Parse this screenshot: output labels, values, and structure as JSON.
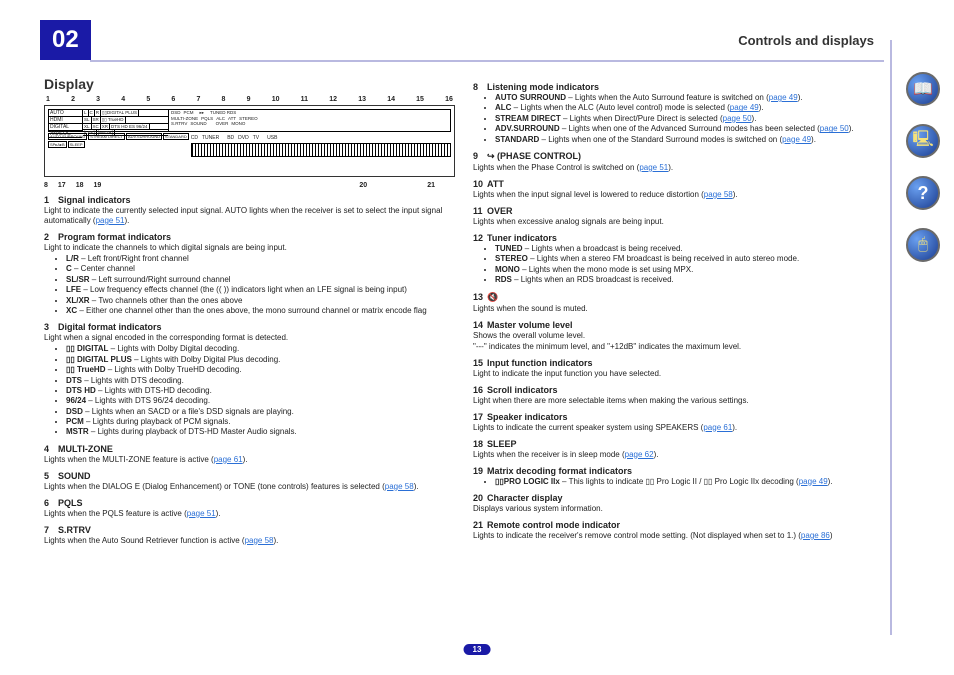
{
  "chapter": "02",
  "header_title": "Controls and displays",
  "page_number": "13",
  "display_heading": "Display",
  "top_callouts": [
    "1",
    "2",
    "3",
    "4",
    "5",
    "6",
    "7",
    "8",
    "9",
    "10",
    "11",
    "12",
    "13",
    "14",
    "15",
    "16"
  ],
  "bot_callouts_left": [
    "8",
    "17",
    "18",
    "19"
  ],
  "bot_callouts_right": [
    "20",
    "21"
  ],
  "panel1": [
    "AUTO",
    "HDMI",
    "DIGITAL",
    "ANALOG"
  ],
  "panel2_row1": [
    "L",
    "C",
    "R",
    "▯▯DIGITAL PLUS"
  ],
  "panel2_row2": [
    "SL",
    "SR",
    "▯▯ TrueHD"
  ],
  "panel2_row3": [
    "XL",
    "XC",
    "XR",
    "DTS HD ES 96/24"
  ],
  "panel2_row4": [
    "[LFE]",
    "[MSTR]"
  ],
  "panel3_row1": [
    "DSD",
    "PCM",
    "",
    "▸▸",
    "",
    "TUNED RDS"
  ],
  "panel3_row2": [
    "MULTI-ZONE",
    "PQLS",
    "ALC",
    "ATT",
    "STEREO"
  ],
  "panel3_row3": [
    "S.RTRV",
    "SOUND",
    "",
    "",
    "OVER",
    "MONO"
  ],
  "midrow": [
    "CD",
    "TUNER",
    "",
    "BD",
    "DVD",
    "TV",
    "",
    "USB"
  ],
  "midrow2": [
    "",
    "",
    "iPod",
    "",
    "DVD",
    "DVR",
    "HDMI",
    "[ 2 ]",
    "[ 3 ]",
    "[ 4 ]"
  ],
  "modes": [
    "AUTO SURROUND",
    "STREAM DIRECT",
    "ADV.SURROUND",
    "STANDARD"
  ],
  "modes2": [
    "SP▸A▸B",
    "SLEEP"
  ],
  "left": {
    "s1": {
      "num": "1",
      "title": "Signal indicators",
      "desc": "Light to indicate the currently selected input signal. AUTO lights when the receiver is set to select the input signal automatically (",
      "xref": "page 51",
      "desc_end": ")."
    },
    "s2": {
      "num": "2",
      "title": "Program format indicators",
      "desc": "Light to indicate the channels to which digital signals are being input.",
      "items": [
        {
          "b": "L/R",
          "t": " – Left front/Right front channel"
        },
        {
          "b": "C",
          "t": " – Center channel"
        },
        {
          "b": "SL/SR",
          "t": " – Left surround/Right surround channel"
        },
        {
          "b": "LFE",
          "t": " – Low frequency effects channel (the (( )) indicators light when an LFE signal is being input)"
        },
        {
          "b": "XL/XR",
          "t": " – Two channels other than the ones above"
        },
        {
          "b": "XC",
          "t": " – Either one channel other than the ones above, the mono surround channel or matrix encode flag"
        }
      ]
    },
    "s3": {
      "num": "3",
      "title": "Digital format indicators",
      "desc": "Light when a signal encoded in the corresponding format is detected.",
      "items": [
        {
          "b": "▯▯ DIGITAL",
          "t": " – Lights with Dolby Digital decoding."
        },
        {
          "b": "▯▯ DIGITAL PLUS",
          "t": " – Lights with Dolby Digital Plus decoding."
        },
        {
          "b": "▯▯ TrueHD",
          "t": " – Lights with Dolby TrueHD decoding."
        },
        {
          "b": "DTS",
          "t": " – Lights with DTS decoding."
        },
        {
          "b": "DTS HD",
          "t": " – Lights with DTS-HD decoding."
        },
        {
          "b": "96/24",
          "t": " – Lights with DTS 96/24 decoding."
        },
        {
          "b": "DSD",
          "t": " – Lights when an SACD or a file's DSD signals are playing."
        },
        {
          "b": "PCM",
          "t": " – Lights during playback of PCM signals."
        },
        {
          "b": "MSTR",
          "t": " – Lights during playback of DTS-HD Master Audio signals."
        }
      ]
    },
    "s4": {
      "num": "4",
      "title": "MULTI-ZONE",
      "desc": "Lights when the MULTI-ZONE feature is active (",
      "xref": "page 61",
      "desc_end": ")."
    },
    "s5": {
      "num": "5",
      "title": "SOUND",
      "desc": "Lights when the DIALOG E (Dialog Enhancement) or TONE (tone controls) features is selected (",
      "xref": "page 58",
      "desc_end": ")."
    },
    "s6": {
      "num": "6",
      "title": "PQLS",
      "desc": "Lights when the PQLS feature is active (",
      "xref": "page 51",
      "desc_end": ")."
    },
    "s7": {
      "num": "7",
      "title": "S.RTRV",
      "desc": "Lights when the Auto Sound Retriever function is active (",
      "xref": "page 58",
      "desc_end": ")."
    }
  },
  "right": {
    "s8": {
      "num": "8",
      "title": "Listening mode indicators",
      "items": [
        {
          "b": "AUTO SURROUND",
          "t": " – Lights when the Auto Surround feature is switched on (",
          "xref": "page 49",
          "end": ")."
        },
        {
          "b": "ALC",
          "t": " – Lights when the ALC (Auto level control) mode is selected (",
          "xref": "page 49",
          "end": ")."
        },
        {
          "b": "STREAM DIRECT",
          "t": " – Lights when Direct/Pure Direct is selected (",
          "xref": "page 50",
          "end": ")."
        },
        {
          "b": "ADV.SURROUND",
          "t": " – Lights when one of the Advanced Surround modes has been selected (",
          "xref": "page 50",
          "end": ")."
        },
        {
          "b": "STANDARD",
          "t": " – Lights when one of the Standard Surround modes is switched on (",
          "xref": "page 49",
          "end": ")."
        }
      ]
    },
    "s9": {
      "num": "9",
      "title": "  (PHASE CONTROL)",
      "icon": "↪",
      "desc": "Lights when the Phase Control is switched on (",
      "xref": "page 51",
      "desc_end": ")."
    },
    "s10": {
      "num": "10",
      "title": "ATT",
      "desc": "Lights when the input signal level is lowered to reduce distortion (",
      "xref": "page 58",
      "desc_end": ")."
    },
    "s11": {
      "num": "11",
      "title": "OVER",
      "desc": "Lights when excessive analog signals are being input."
    },
    "s12": {
      "num": "12",
      "title": "Tuner indicators",
      "items": [
        {
          "b": "TUNED",
          "t": " – Lights when a broadcast is being received."
        },
        {
          "b": "STEREO",
          "t": " – Lights when a stereo FM broadcast is being received in auto stereo mode."
        },
        {
          "b": "MONO",
          "t": " – Lights when the mono mode is set using MPX."
        },
        {
          "b": "RDS",
          "t": " – Lights when an RDS broadcast is received."
        }
      ]
    },
    "s13": {
      "num": "13",
      "title": "",
      "icon": "🔇",
      "desc": "Lights when the sound is muted."
    },
    "s14": {
      "num": "14",
      "title": "Master volume level",
      "desc": "Shows the overall volume level.",
      "desc2": "\"---\" indicates the minimum level, and \"+12dB\" indicates the maximum level."
    },
    "s15": {
      "num": "15",
      "title": "Input function indicators",
      "desc": "Light to indicate the input function you have selected."
    },
    "s16": {
      "num": "16",
      "title": "Scroll indicators",
      "desc": "Light when there are more selectable items when making the various settings."
    },
    "s17": {
      "num": "17",
      "title": "Speaker indicators",
      "desc": "Lights to indicate the current speaker system using SPEAKERS (",
      "xref": "page 61",
      "desc_end": ")."
    },
    "s18": {
      "num": "18",
      "title": "SLEEP",
      "desc": "Lights when the receiver is in sleep mode (",
      "xref": "page 62",
      "desc_end": ")."
    },
    "s19": {
      "num": "19",
      "title": "Matrix decoding format indicators",
      "items": [
        {
          "b": "▯▯PRO LOGIC IIx",
          "t": " – This lights to indicate ▯▯ Pro Logic II / ▯▯ Pro Logic IIx decoding (",
          "xref": "page 49",
          "end": ")."
        }
      ]
    },
    "s20": {
      "num": "20",
      "title": "Character display",
      "desc": "Displays various system information."
    },
    "s21": {
      "num": "21",
      "title": "Remote control mode indicator",
      "desc": "Lights to indicate the receiver's remove control mode setting. (Not displayed when set to 1.) (",
      "xref": "page 86",
      "desc_end": ")"
    }
  }
}
